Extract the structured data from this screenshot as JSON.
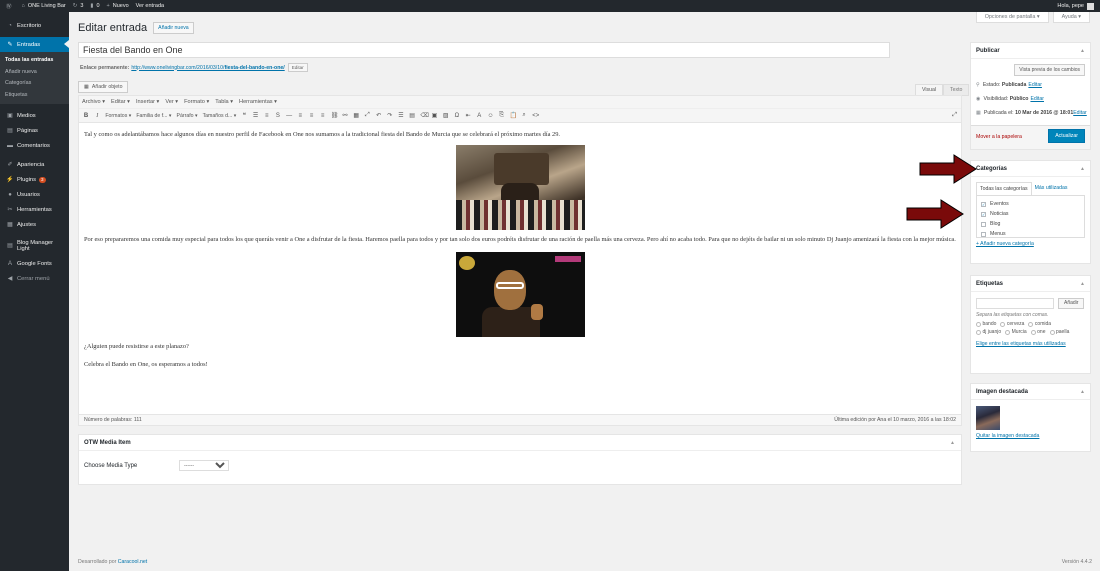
{
  "adminbar": {
    "wp_icon": "wordpress-icon",
    "site_name": "ONE Living Bar",
    "updates_count": "3",
    "comments_count": "0",
    "new_label": "Nuevo",
    "view_label": "Ver entrada",
    "greeting": "Hola, pepe"
  },
  "sidebar": {
    "items": [
      {
        "label": "Escritorio",
        "icon": "dashboard-icon"
      },
      {
        "label": "Entradas",
        "icon": "pin-icon"
      },
      {
        "label": "Medios",
        "icon": "media-icon"
      },
      {
        "label": "Páginas",
        "icon": "page-icon"
      },
      {
        "label": "Comentarios",
        "icon": "comment-icon"
      },
      {
        "label": "Apariencia",
        "icon": "brush-icon"
      },
      {
        "label": "Plugins",
        "icon": "plugin-icon",
        "badge": "3"
      },
      {
        "label": "Usuarios",
        "icon": "user-icon"
      },
      {
        "label": "Herramientas",
        "icon": "wrench-icon"
      },
      {
        "label": "Ajustes",
        "icon": "settings-icon"
      },
      {
        "label": "Blog Manager Light",
        "icon": "blog-icon"
      },
      {
        "label": "Google Fonts",
        "icon": "font-icon"
      },
      {
        "label": "Cerrar menú",
        "icon": "collapse-icon"
      }
    ],
    "submenu": [
      "Todas las entradas",
      "Añadir nueva",
      "Categorías",
      "Etiquetas"
    ]
  },
  "screen_options": {
    "options": "Opciones de pantalla",
    "help": "Ayuda"
  },
  "page": {
    "title": "Editar entrada",
    "add_new": "Añadir nueva",
    "post_title": "Fiesta del Bando en One",
    "permalink_label": "Enlace permanente:",
    "permalink_base": "http://www.onelivingbar.com/2016/03/10/",
    "permalink_slug": "fiesta-del-bando-en-one/",
    "permalink_edit": "Editar",
    "add_media": "Añadir objeto",
    "tab_visual": "Visual",
    "tab_text": "Texto"
  },
  "editor": {
    "menubar": [
      "Archivo ▾",
      "Editar ▾",
      "Insertar ▾",
      "Ver ▾",
      "Formato ▾",
      "Tabla ▾",
      "Herramientas ▾"
    ],
    "toolbar": {
      "formats": "Formatos ▾",
      "font_family": "Familia de f... ▾",
      "paragraph": "Párrafo ▾",
      "font_size": "Tamaños d... ▾"
    },
    "paragraphs": {
      "p1": "Tal y como os adelantábamos hace algunos días en nuestro perfil de Facebook en One nos sumamos a la tradicional fiesta del Bando de Murcia que se celebrará el próximo martes día 29.",
      "p2": "Por eso prepararemos una comida muy especial para todos los que queráis venir a One a disfrutar de la fiesta. Haremos paella para todos y por tan solo dos euros podréis disfrutar de una ración de paella más una cerveza. Pero ahí no acaba todo. Para que no dejéis de bailar ni un solo minuto Dj Juanjo amenizará la fiesta con la mejor música.",
      "p3": "¿Alguien puede resistirse a este planazo?",
      "p4": "Celebra el Bando en One, os esperamos a todos!"
    },
    "word_count": "Número de palabras: 111",
    "last_edit": "Última edición por Ana el 10 marzo, 2016 a las 18:02"
  },
  "otw": {
    "title": "OTW Media Item",
    "field_label": "Choose Media Type",
    "selected": "------"
  },
  "publish": {
    "title": "Publicar",
    "preview": "Vista previa de los cambios",
    "status_label": "Estado:",
    "status_value": "Publicada",
    "visibility_label": "Visibilidad:",
    "visibility_value": "Público",
    "published_label": "Publicada el:",
    "published_value": "10 Mar de 2016 @ 18:01",
    "edit": "Editar",
    "trash": "Mover a la papelera",
    "update": "Actualizar"
  },
  "categories": {
    "title": "Categorías",
    "tab_all": "Todas las categorías",
    "tab_most": "Más utilizadas",
    "items": [
      {
        "label": "Eventos",
        "checked": true
      },
      {
        "label": "Noticias",
        "checked": true
      },
      {
        "label": "Blog",
        "checked": false
      },
      {
        "label": "Menus",
        "checked": false
      }
    ],
    "add_new": "+ Añadir nueva categoría"
  },
  "tags": {
    "title": "Etiquetas",
    "add_button": "Añadir",
    "hint": "Separa las etiquetas con comas.",
    "items": [
      "bando",
      "cerveza",
      "comida",
      "dj juanjo",
      "Murcia",
      "one",
      "paella"
    ],
    "choose_link": "Elige entre las etiquetas más utilizadas"
  },
  "featured": {
    "title": "Imagen destacada",
    "remove_link": "Quitar la imagen destacada"
  },
  "footer": {
    "credit": "Desarrollado por ",
    "credit_link": "Caracool.net",
    "version": "Versión 4.4.2"
  },
  "colors": {
    "accent": "#0073aa",
    "admin_dark": "#23282d",
    "arrow": "#7a0a0a",
    "update_button": "#0085ba"
  }
}
